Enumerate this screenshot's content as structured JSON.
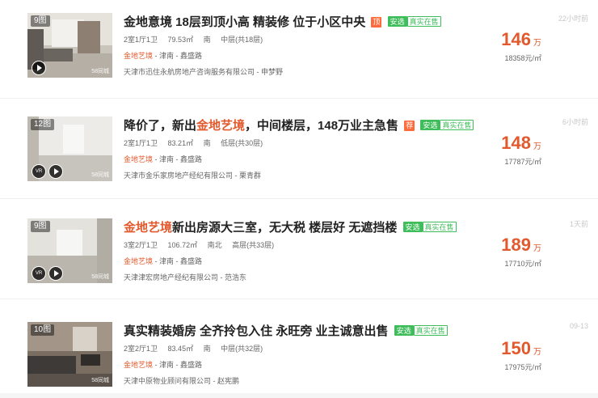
{
  "listings": [
    {
      "photo_count": "9图",
      "title_parts": [
        "金地意境 18层到顶小高 精装修 位于小区中央"
      ],
      "title_highlight": "",
      "badges": [
        "顶",
        "安选",
        "真实在售"
      ],
      "layout": "2室1厅1卫",
      "area": "79.53㎡",
      "orientation": "南",
      "floor": "中层(共18层)",
      "community": "金地艺境",
      "district": "津南",
      "road": "鑫盛路",
      "agent": "天津市迅住永航房地产咨询服务有限公司 - 申梦野",
      "price": "146",
      "price_unit": "万",
      "unit_price": "18358元/㎡",
      "time": "22小时前",
      "has_vr": false,
      "watermark": "58同城"
    },
    {
      "photo_count": "12图",
      "title_before": "降价了，新出",
      "title_highlight": "金地艺境",
      "title_after": "，中间楼层，148万业主急售",
      "badges": [
        "荐",
        "安选",
        "真实在售"
      ],
      "layout": "2室1厅1卫",
      "area": "83.21㎡",
      "orientation": "南",
      "floor": "低层(共30层)",
      "community": "金地艺境",
      "district": "津南",
      "road": "鑫盛路",
      "agent": "天津市金乐家房地产经纪有限公司 - 栗青群",
      "price": "148",
      "price_unit": "万",
      "unit_price": "17787元/㎡",
      "time": "6小时前",
      "has_vr": true,
      "watermark": "58同城"
    },
    {
      "photo_count": "9图",
      "title_before": "",
      "title_highlight": "金地艺境",
      "title_after": "新出房源大三室，无大税 楼层好 无遮挡楼",
      "badges": [
        "安选",
        "真实在售"
      ],
      "layout": "3室2厅1卫",
      "area": "106.72㎡",
      "orientation": "南北",
      "floor": "高层(共33层)",
      "community": "金地艺境",
      "district": "津南",
      "road": "鑫盛路",
      "agent": "天津津宏房地产经纪有限公司 - 范浩东",
      "price": "189",
      "price_unit": "万",
      "unit_price": "17710元/㎡",
      "time": "1天前",
      "has_vr": true,
      "watermark": "58同城"
    },
    {
      "photo_count": "10图",
      "title_before": "真实精装婚房 全齐拎包入住 永旺旁 业主诚意出售",
      "title_highlight": "",
      "title_after": "",
      "badges": [
        "安选",
        "真实在售"
      ],
      "layout": "2室2厅1卫",
      "area": "83.45㎡",
      "orientation": "南",
      "floor": "中层(共32层)",
      "community": "金地艺境",
      "district": "津南",
      "road": "鑫盛路",
      "agent": "天津中原物业顾问有限公司 - 赵宪鹏",
      "price": "150",
      "price_unit": "万",
      "unit_price": "17975元/㎡",
      "time": "09-13",
      "has_vr": false,
      "watermark": "58同城"
    }
  ],
  "separator": " - ",
  "colors": {
    "accent": "#e2592d",
    "green": "#3fbd5b",
    "top_badge": "#ff6a3c"
  },
  "icons": [
    "play-icon",
    "vr-icon"
  ]
}
